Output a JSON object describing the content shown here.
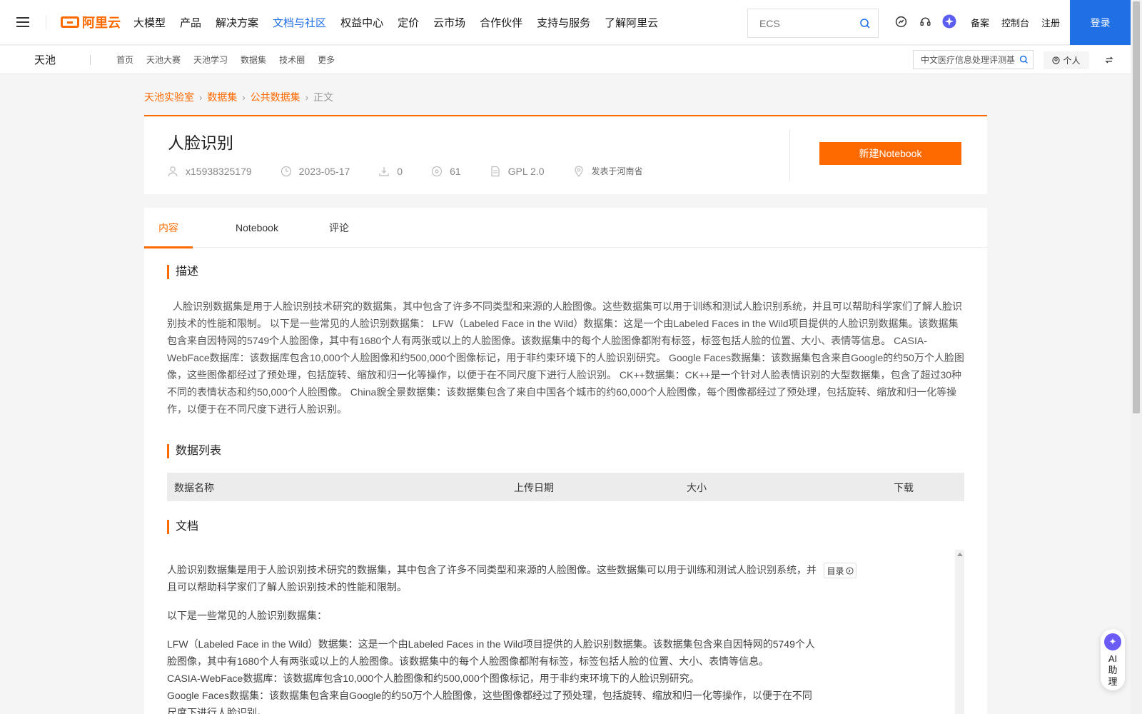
{
  "topnav": {
    "logo_text": "阿里云",
    "items": [
      "大模型",
      "产品",
      "解决方案",
      "文档与社区",
      "权益中心",
      "定价",
      "云市场",
      "合作伙伴",
      "支持与服务",
      "了解阿里云"
    ],
    "active_index": 3,
    "search_placeholder": "ECS",
    "links": [
      "备案",
      "控制台",
      "注册"
    ],
    "login_label": "登录"
  },
  "subnav": {
    "brand": "天池",
    "links": [
      "首页",
      "天池大赛",
      "天池学习",
      "数据集",
      "技术圈",
      "更多"
    ],
    "search_value": "中文医疗信息处理评测基",
    "personal_label": "个人"
  },
  "breadcrumb": {
    "items": [
      "天池实验室",
      "数据集",
      "公共数据集"
    ],
    "current": "正文"
  },
  "dataset": {
    "title": "人脸识别",
    "author": "x15938325179",
    "date": "2023-05-17",
    "downloads": "0",
    "views": "61",
    "license": "GPL 2.0",
    "location": "发表于河南省",
    "notebook_button": "新建Notebook"
  },
  "tabs": [
    "内容",
    "Notebook",
    "评论"
  ],
  "sections": {
    "description_title": "描述",
    "description": "人脸识别数据集是用于人脸识别技术研究的数据集，其中包含了许多不同类型和来源的人脸图像。这些数据集可以用于训练和测试人脸识别系统，并且可以帮助科学家们了解人脸识别技术的性能和限制。 以下是一些常见的人脸识别数据集： LFW（Labeled Face in the Wild）数据集：这是一个由Labeled Faces in the Wild项目提供的人脸识别数据集。该数据集包含来自因特网的5749个人脸图像，其中有1680个人有两张或以上的人脸图像。该数据集中的每个人脸图像都附有标签，标签包括人脸的位置、大小、表情等信息。 CASIA-WebFace数据库：该数据库包含10,000个人脸图像和约500,000个图像标记，用于非约束环境下的人脸识别研究。 Google Faces数据集：该数据集包含来自Google的约50万个人脸图像，这些图像都经过了预处理，包括旋转、缩放和归一化等操作，以便于在不同尺度下进行人脸识别。 CK++数据集：CK++是一个针对人脸表情识别的大型数据集，包含了超过30种不同的表情状态和约50,000个人脸图像。 China貌全景数据集：该数据集包含了来自中国各个城市的约60,000个人脸图像，每个图像都经过了预处理，包括旋转、缩放和归一化等操作，以便于在不同尺度下进行人脸识别。",
    "datalist_title": "数据列表",
    "table_headers": [
      "数据名称",
      "上传日期",
      "大小",
      "下载"
    ],
    "docs_title": "文档",
    "toc_label": "目录",
    "doc_paragraphs": [
      "人脸识别数据集是用于人脸识别技术研究的数据集，其中包含了许多不同类型和来源的人脸图像。这些数据集可以用于训练和测试人脸识别系统，并且可以帮助科学家们了解人脸识别技术的性能和限制。",
      "以下是一些常见的人脸识别数据集：",
      "LFW（Labeled Face in the Wild）数据集：这是一个由Labeled Faces in the Wild项目提供的人脸识别数据集。该数据集包含来自因特网的5749个人脸图像，其中有1680个人有两张或以上的人脸图像。该数据集中的每个人脸图像都附有标签，标签包括人脸的位置、大小、表情等信息。",
      "CASIA-WebFace数据库：该数据库包含10,000个人脸图像和约500,000个图像标记，用于非约束环境下的人脸识别研究。",
      "Google Faces数据集：该数据集包含来自Google的约50万个人脸图像，这些图像都经过了预处理，包括旋转、缩放和归一化等操作，以便于在不同尺度下进行人脸识别。"
    ]
  },
  "ai_assistant": {
    "label": "AI助理"
  },
  "colors": {
    "accent": "#ff6a00",
    "brand_blue": "#1f6fe5"
  }
}
